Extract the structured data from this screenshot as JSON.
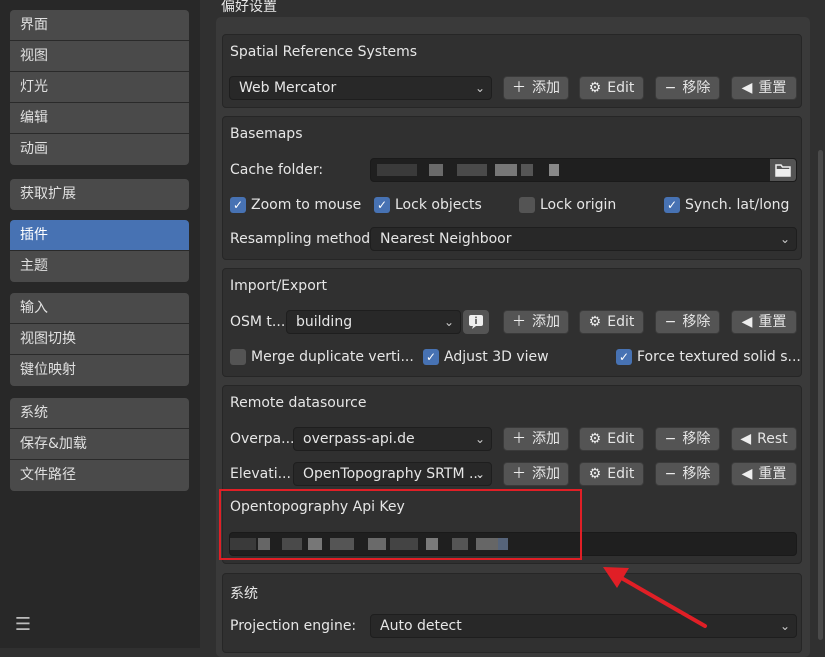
{
  "sidebar": {
    "groups": [
      [
        {
          "label": "界面"
        },
        {
          "label": "视图"
        },
        {
          "label": "灯光"
        },
        {
          "label": "编辑"
        },
        {
          "label": "动画"
        }
      ],
      [
        {
          "label": "获取扩展"
        }
      ],
      [
        {
          "label": "插件",
          "active": true
        },
        {
          "label": "主题"
        }
      ],
      [
        {
          "label": "输入"
        },
        {
          "label": "视图切换"
        },
        {
          "label": "键位映射"
        }
      ],
      [
        {
          "label": "系统"
        },
        {
          "label": "保存&加载"
        },
        {
          "label": "文件路径"
        }
      ]
    ]
  },
  "page": {
    "title": "偏好设置"
  },
  "srs": {
    "title": "Spatial Reference Systems",
    "selected": "Web Mercator",
    "add": "添加",
    "edit": "Edit",
    "remove": "移除",
    "reset": "重置"
  },
  "basemaps": {
    "title": "Basemaps",
    "cache_label": "Cache folder:",
    "zoom": "Zoom to mouse",
    "lock_objects": "Lock objects",
    "lock_origin": "Lock origin",
    "synch": "Synch. lat/long",
    "resampling_label": "Resampling method:",
    "resampling_value": "Nearest Neighboor"
  },
  "importexport": {
    "title": "Import/Export",
    "osm_label": "OSM t...",
    "osm_value": "building",
    "add": "添加",
    "edit": "Edit",
    "remove": "移除",
    "reset": "重置",
    "merge": "Merge duplicate verti...",
    "adjust": "Adjust 3D view",
    "force": "Force textured solid s..."
  },
  "remote": {
    "title": "Remote datasource",
    "overpass_label": "Overpa...",
    "overpass_value": "overpass-api.de",
    "elev_label": "Elevati...",
    "elev_value": "OpenTopography SRTM ...",
    "add": "添加",
    "edit": "Edit",
    "remove": "移除",
    "rest": "Rest",
    "reset": "重置",
    "api_label": "Opentopography Api Key"
  },
  "system": {
    "title": "系统",
    "proj_label": "Projection engine:",
    "proj_value": "Auto detect"
  },
  "colors": {
    "accent": "#4772b3",
    "highlight": "#e01f26"
  }
}
